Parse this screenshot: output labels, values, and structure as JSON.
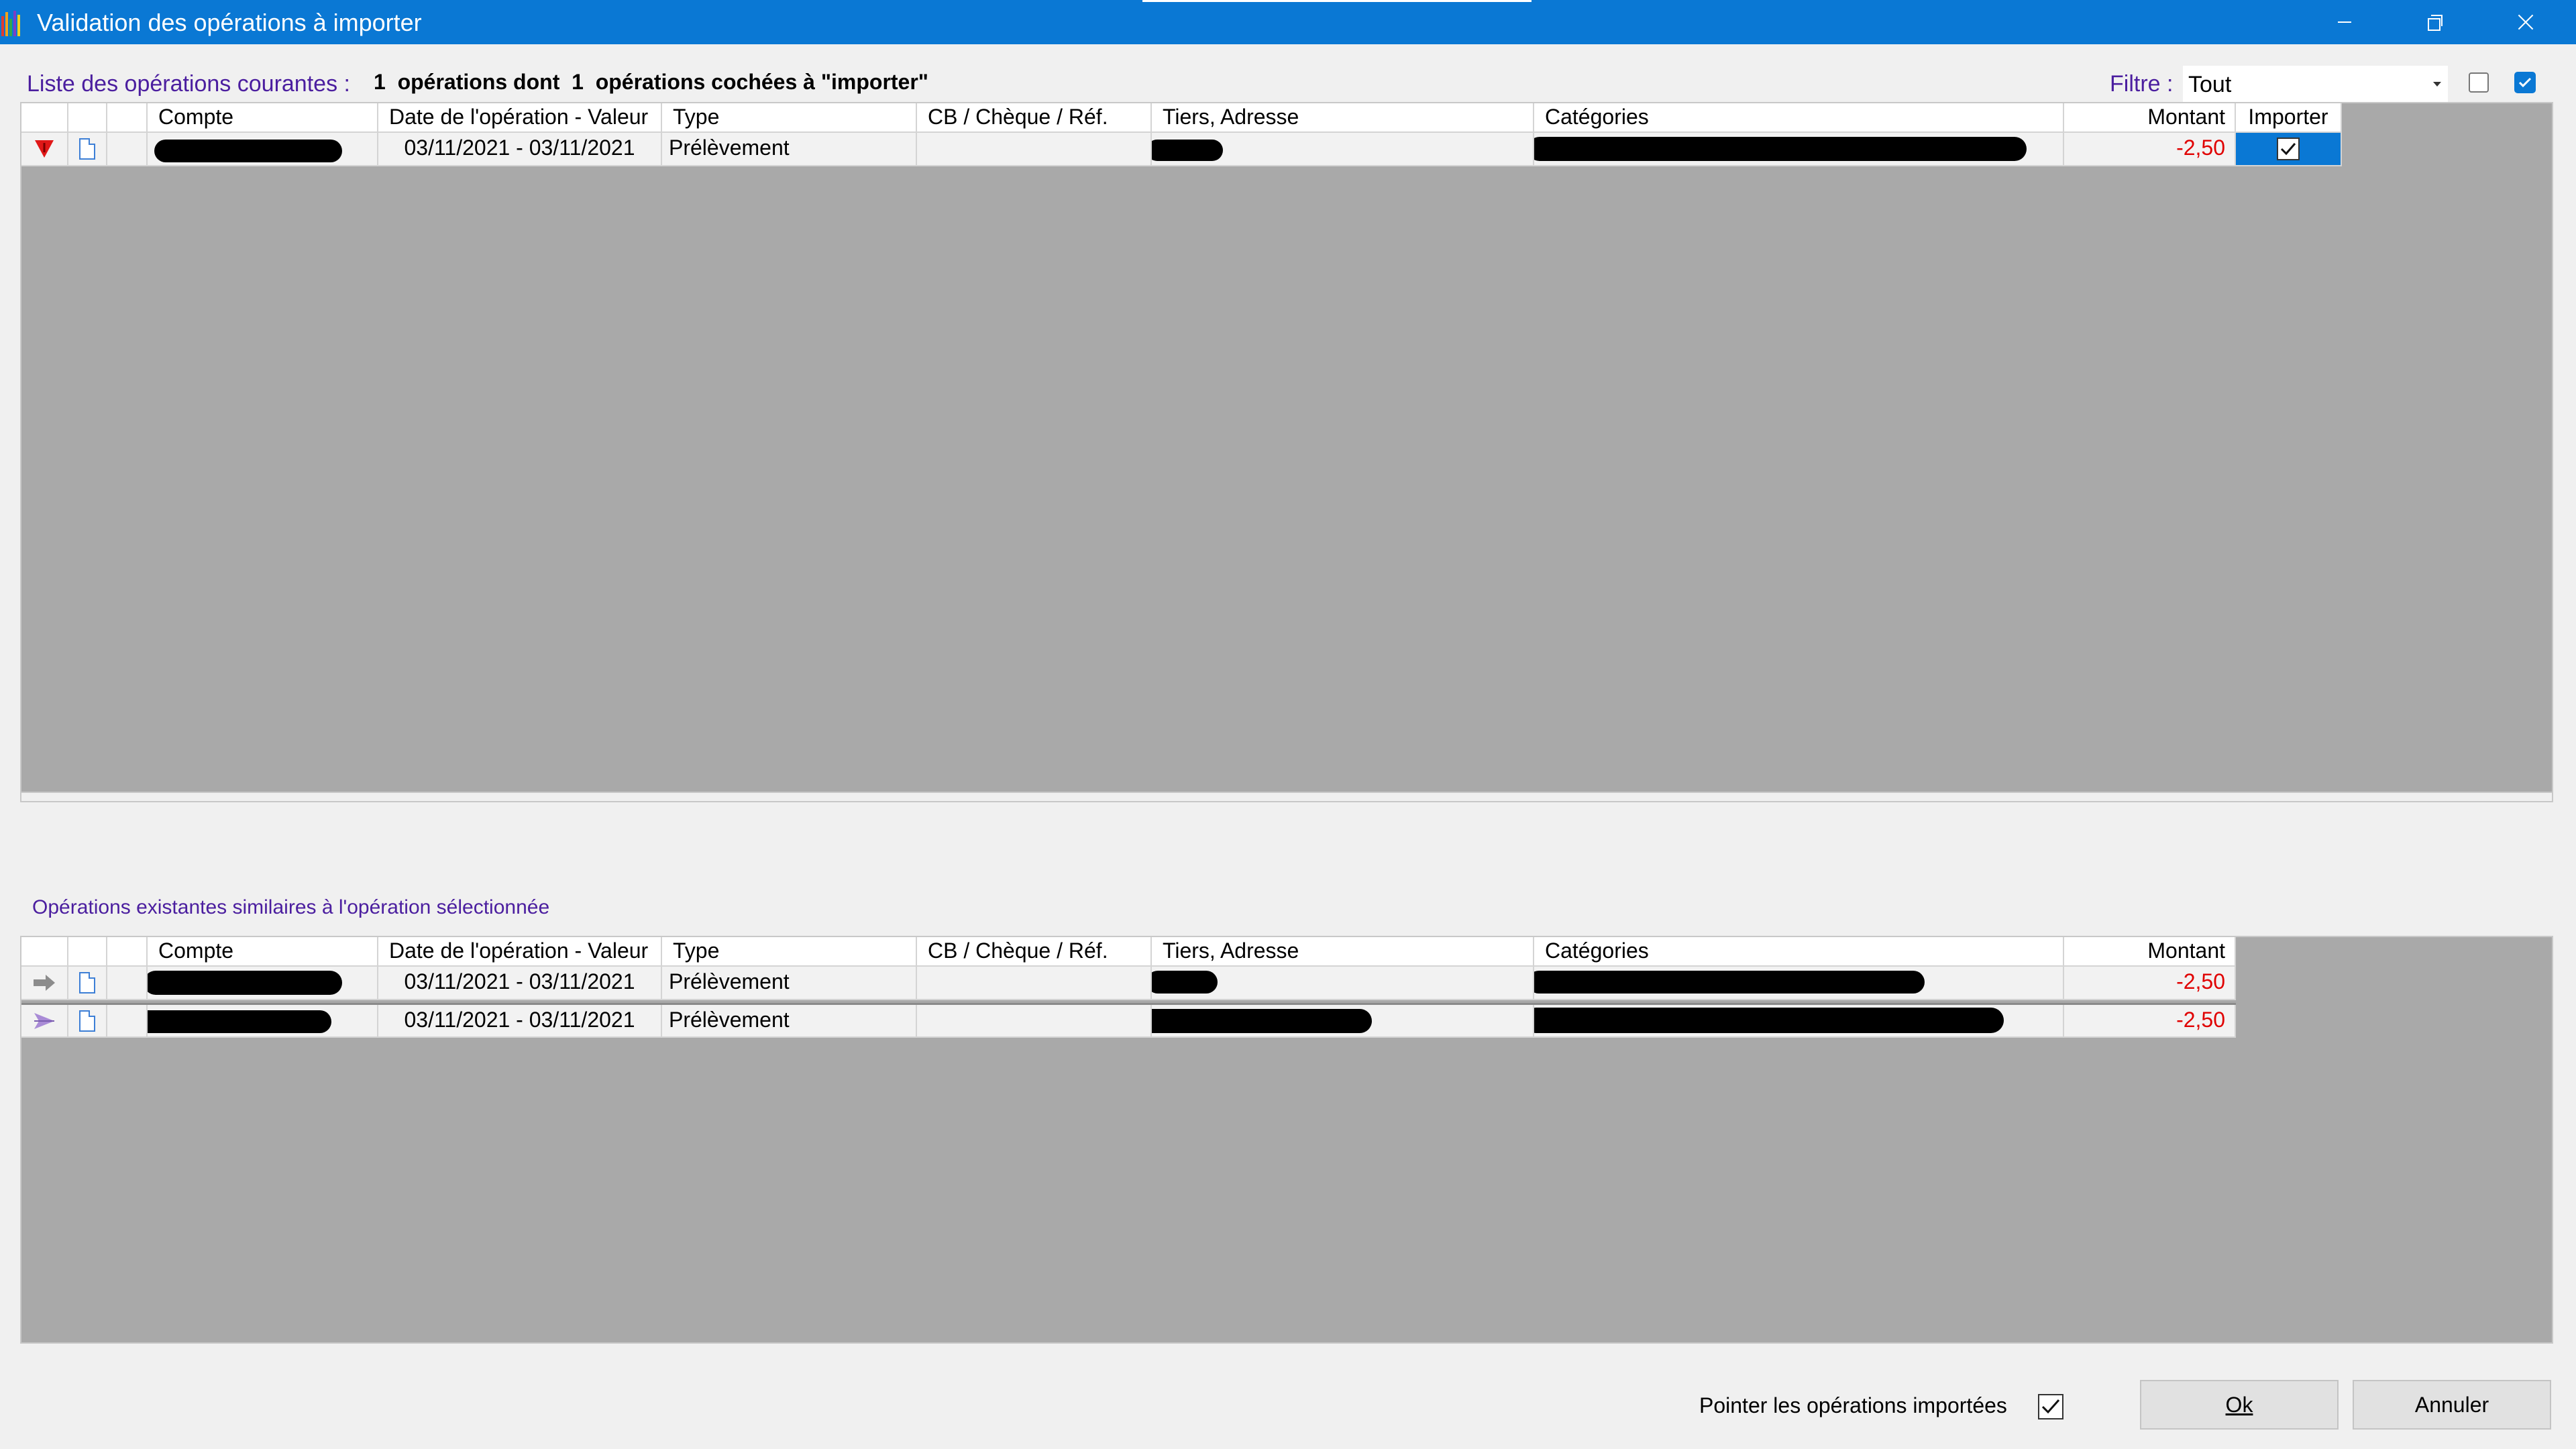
{
  "window": {
    "title": "Validation des opérations à importer",
    "icons": [
      "app-icon",
      "minimize-icon",
      "restore-icon",
      "close-icon"
    ]
  },
  "current_list": {
    "label": "Liste des opérations courantes :",
    "summary": "1  opérations dont  1  opérations cochées à \"importer\"",
    "filter_label": "Filtre :",
    "filter_value": "Tout",
    "select_none_checked": false,
    "select_all_checked": true
  },
  "columns": {
    "compte": "Compte",
    "date": "Date de l'opération - Valeur",
    "type": "Type",
    "cb": "CB / Chèque / Réf.",
    "tiers": "Tiers, Adresse",
    "categories": "Catégories",
    "montant": "Montant",
    "importer": "Importer"
  },
  "current_rows": [
    {
      "status_icon": "red-down-triangle-icon",
      "doc_icon": "document-icon",
      "date": "03/11/2021 - 03/11/2021",
      "type": "Prélèvement",
      "cb": "",
      "amount": "-2,50",
      "import_checked": true
    }
  ],
  "similar": {
    "label": "Opérations existantes similaires à l'opération sélectionnée",
    "rows": [
      {
        "status_icon": "gray-arrow-right-icon",
        "doc_icon": "document-icon",
        "date": "03/11/2021 - 03/11/2021",
        "type": "Prélèvement",
        "cb": "",
        "amount": "-2,50"
      },
      {
        "status_icon": "purple-pennant-icon",
        "doc_icon": "document-icon",
        "date": "03/11/2021 - 03/11/2021",
        "type": "Prélèvement",
        "cb": "",
        "amount": "-2,50"
      }
    ]
  },
  "footer": {
    "pointer_label": "Pointer les opérations importées",
    "pointer_checked": true,
    "ok_label": "Ok",
    "cancel_label": "Annuler"
  },
  "colors": {
    "title_bar": "#0a78d4",
    "section_label": "#4b1e9f",
    "amount_negative": "#e00000",
    "grid_background": "#a9a9a9"
  }
}
